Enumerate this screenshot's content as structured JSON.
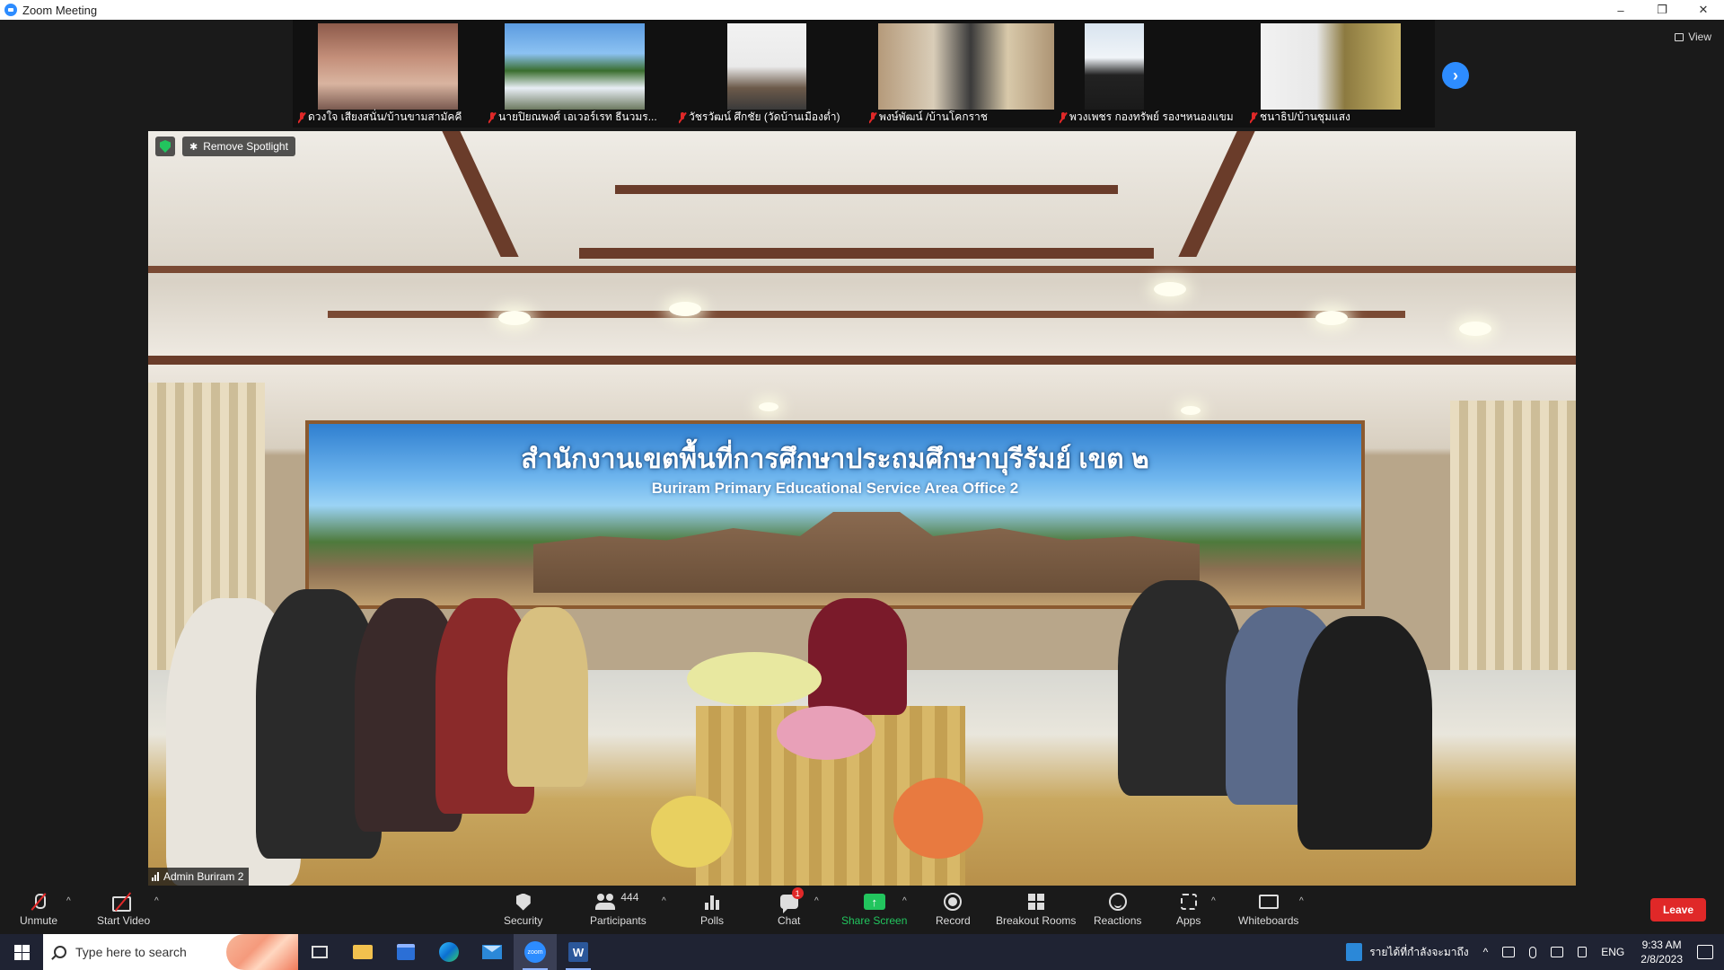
{
  "window": {
    "title": "Zoom Meeting",
    "minimize": "–",
    "restore": "❐",
    "close": "✕"
  },
  "view_button": {
    "label": "View"
  },
  "thumbnails": [
    {
      "name": "ดวงใจ เสียงสนั่น/บ้านขามสามัคคี"
    },
    {
      "name": "นายปิยณพงศ์ เอเวอร์เรท ธีนวมร..."
    },
    {
      "name": "วัชรวัฒน์ ศึกชัย (วัดบ้านเมืองต่ำ)"
    },
    {
      "name": "พงษ์พัฒน์ /บ้านโคกราช"
    },
    {
      "name": "พวงเพชร กองทรัพย์ รองฯหนองแขม"
    },
    {
      "name": "ชนาธิป/บ้านชุมแสง"
    }
  ],
  "spotlight": {
    "remove_label": "Remove Spotlight",
    "participant_name": "Admin Buriram 2",
    "banner_title": "สำนักงานเขตพื้นที่การศึกษาประถมศึกษาบุรีรัมย์ เขต ๒",
    "banner_subtitle": "Buriram Primary Educational Service Area Office 2"
  },
  "toolbar": {
    "unmute": "Unmute",
    "start_video": "Start Video",
    "security": "Security",
    "participants": "Participants",
    "participants_count": "444",
    "polls": "Polls",
    "chat": "Chat",
    "chat_badge": "1",
    "share_screen": "Share Screen",
    "record": "Record",
    "breakout_rooms": "Breakout Rooms",
    "reactions": "Reactions",
    "apps": "Apps",
    "whiteboards": "Whiteboards",
    "leave": "Leave",
    "caret": "^"
  },
  "taskbar": {
    "search_placeholder": "Type here to search",
    "news_text": "รายได้ที่กำลังจะมาถึง",
    "language": "ENG",
    "time": "9:33 AM",
    "date": "2/8/2023",
    "tray_up": "^",
    "word_letter": "W",
    "zoom_text": "zoom"
  },
  "colors": {
    "accent_blue": "#2d8cff",
    "leave_red": "#e02828",
    "share_green": "#22c55e"
  }
}
